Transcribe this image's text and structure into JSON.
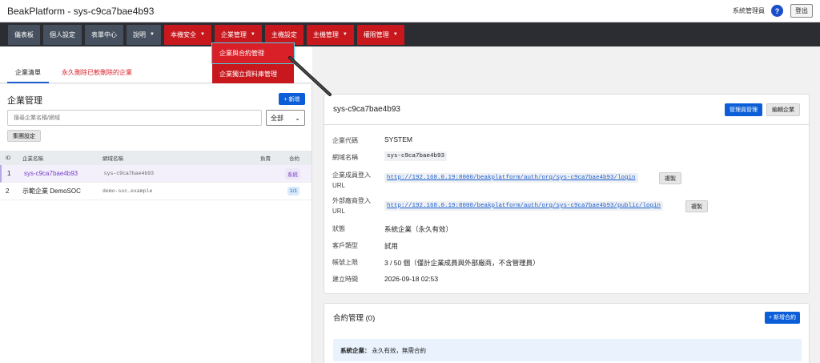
{
  "app": {
    "title": "BeakPlatform - sys-c9ca7bae4b93",
    "user": "系統管理員",
    "help": "?",
    "logout": "登出"
  },
  "nav": [
    {
      "label": "儀表板",
      "style": "dark",
      "caret": false
    },
    {
      "label": "個人設定",
      "style": "dark",
      "caret": false
    },
    {
      "label": "表單中心",
      "style": "dark",
      "caret": false
    },
    {
      "label": "說明",
      "style": "dark",
      "caret": true
    },
    {
      "label": "本機安全",
      "style": "red",
      "caret": true
    },
    {
      "label": "企業管理",
      "style": "red",
      "caret": true
    },
    {
      "label": "主機設定",
      "style": "red",
      "caret": false
    },
    {
      "label": "主機管理",
      "style": "red",
      "caret": true
    },
    {
      "label": "權限管理",
      "style": "red",
      "caret": true
    }
  ],
  "dropdown": [
    "企業與合約管理",
    "企業獨立資料庫管理"
  ],
  "tabs": {
    "active": "企業清單",
    "deleted": "永久刪除已軟刪除的企業"
  },
  "list": {
    "title": "企業管理",
    "add": "+ 新增",
    "search_placeholder": "搜尋企業名稱/網域",
    "filter": "全部",
    "group": "集團設定",
    "columns": {
      "id": "ID",
      "name": "企業名稱",
      "domain": "網域名稱",
      "owner": "負責",
      "contract": "合約"
    },
    "rows": [
      {
        "id": "1",
        "name": "sys-c9ca7bae4b93",
        "domain": "sys-c9ca7bae4b93",
        "owner": "",
        "contract": "系統"
      },
      {
        "id": "2",
        "name": "示範企業 DemoSOC",
        "domain": "demo-soc.example",
        "owner": "",
        "contract": "1/1"
      }
    ]
  },
  "detail": {
    "title": "sys-c9ca7bae4b93",
    "admin_btn": "管理員管理",
    "edit_btn": "編輯企業",
    "fields": {
      "code_label": "企業代碼",
      "code": "SYSTEM",
      "domain_label": "網域名稱",
      "domain": "sys-c9ca7bae4b93",
      "member_url_label": "企業成員登入 URL",
      "member_url": "http://192.168.0.19:8000/beakplatform/auth/org/sys-c9ca7bae4b93/login",
      "vendor_url_label": "外部廠商登入 URL",
      "vendor_url": "http://192.168.0.19:8000/beakplatform/auth/org/sys-c9ca7bae4b93/public/login",
      "copy": "複製",
      "status_label": "狀態",
      "status": "系統企業（永久有效）",
      "type_label": "客戶類型",
      "type": "試用",
      "quota_label": "帳號上限",
      "quota": "3 / 50 個（僅計企業成員與外部廠商，不含管理員）",
      "created_label": "建立時間",
      "created": "2026-09-18 02:53"
    }
  },
  "contract": {
    "title": "合約管理 (0)",
    "new_btn": "+ 新增合約",
    "info_bold": "系統企業：",
    "info_text": "永久有效，無需合約"
  }
}
